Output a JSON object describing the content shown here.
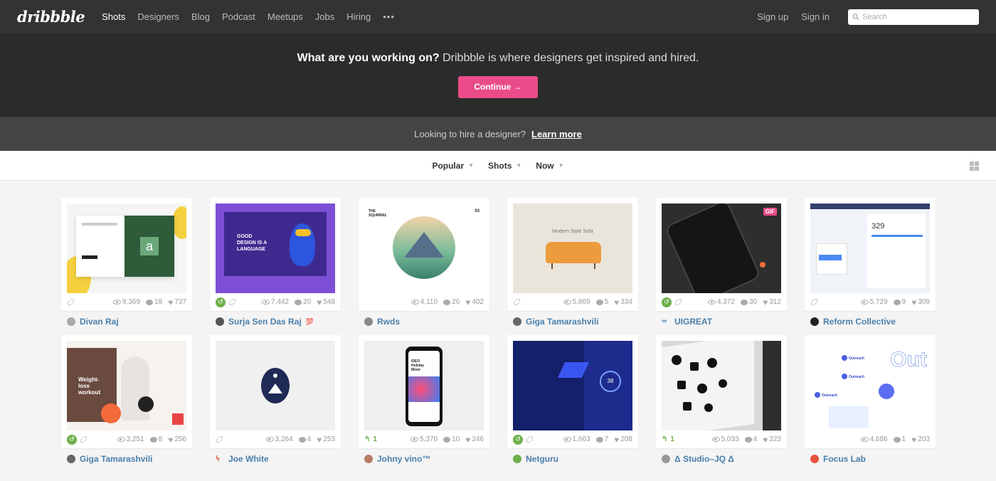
{
  "nav": {
    "logo": "dribbble",
    "links": [
      "Shots",
      "Designers",
      "Blog",
      "Podcast",
      "Meetups",
      "Jobs",
      "Hiring"
    ],
    "more": "•••",
    "signup": "Sign up",
    "signin": "Sign in",
    "search_placeholder": "Search"
  },
  "hero": {
    "bold": "What are you working on?",
    "rest": " Dribbble is where designers get inspired and hired.",
    "cta": "Continue →"
  },
  "hire": {
    "text": "Looking to hire a designer?",
    "link": "Learn more"
  },
  "filters": [
    "Popular",
    "Shots",
    "Now"
  ],
  "shots": [
    {
      "author": "Divan Raj",
      "views": "9,369",
      "comments": "18",
      "likes": "737",
      "rebound": false,
      "rebound_count": ""
    },
    {
      "author": "Surja Sen Das Raj",
      "views": "7,442",
      "comments": "20",
      "likes": "548",
      "rebound": true,
      "rebound_count": "",
      "badge": "💯"
    },
    {
      "author": "Rwds",
      "views": "4,110",
      "comments": "26",
      "likes": "402",
      "rebound": false,
      "rebound_count": ""
    },
    {
      "author": "Giga Tamarashvili",
      "views": "5,869",
      "comments": "5",
      "likes": "334",
      "rebound": false,
      "rebound_count": ""
    },
    {
      "author": "UIGREAT",
      "views": "4,372",
      "comments": "30",
      "likes": "312",
      "rebound": true,
      "rebound_count": ""
    },
    {
      "author": "Reform Collective",
      "views": "5,729",
      "comments": "9",
      "likes": "309",
      "rebound": false,
      "rebound_count": ""
    },
    {
      "author": "Giga Tamarashvili",
      "views": "3,251",
      "comments": "8",
      "likes": "256",
      "rebound": true,
      "rebound_count": ""
    },
    {
      "author": "Joe White",
      "views": "3,264",
      "comments": "4",
      "likes": "253",
      "rebound": false,
      "rebound_count": ""
    },
    {
      "author": "Johny vino™",
      "views": "5,370",
      "comments": "10",
      "likes": "246",
      "rebound": false,
      "rebound_count": "1"
    },
    {
      "author": "Netguru",
      "views": "1,663",
      "comments": "7",
      "likes": "208",
      "rebound": true,
      "rebound_count": ""
    },
    {
      "author": "Δ Studio–JQ Δ",
      "views": "5,033",
      "comments": "4",
      "likes": "223",
      "rebound": false,
      "rebound_count": "1"
    },
    {
      "author": "Focus Lab",
      "views": "4,686",
      "comments": "1",
      "likes": "203",
      "rebound": false,
      "rebound_count": ""
    }
  ],
  "thumb_text": {
    "divan_a": "a",
    "surja_title": "GOOD DESIGN IS A LANGUAGE",
    "rwds_small": "THE SQUIRREL",
    "rwds_num": "03",
    "sofa_caption": "Modern Style Sofa",
    "uigreat_gif": "GIF",
    "reform_number": "329",
    "giga2_title": "Weight-loss workout",
    "johny_title": "IDEO Holiday Mixer",
    "netguru_ring": "38",
    "focus_out": "Out",
    "focus_label": "Outreach"
  },
  "colors": {
    "accent": "#ea4c89",
    "author_link": "#4a7fab",
    "rebound_green": "#6fb04b"
  }
}
